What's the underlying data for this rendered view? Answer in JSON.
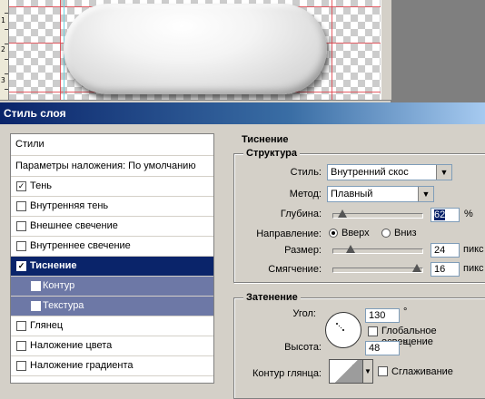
{
  "ruler": {
    "n1": "1",
    "n2": "2",
    "n3": "3"
  },
  "dialog": {
    "title": "Стиль слоя"
  },
  "stylelist": {
    "header": "Стили",
    "blending": "Параметры наложения: По умолчанию",
    "items": [
      {
        "label": "Тень",
        "checked": true
      },
      {
        "label": "Внутренняя тень",
        "checked": false
      },
      {
        "label": "Внешнее свечение",
        "checked": false
      },
      {
        "label": "Внутреннее свечение",
        "checked": false
      },
      {
        "label": "Тиснение",
        "checked": true
      },
      {
        "label": "Контур",
        "checked": false
      },
      {
        "label": "Текстура",
        "checked": false
      },
      {
        "label": "Глянец",
        "checked": false
      },
      {
        "label": "Наложение цвета",
        "checked": false
      },
      {
        "label": "Наложение градиента",
        "checked": false
      }
    ]
  },
  "bevel": {
    "title": "Тиснение",
    "structure": {
      "title": "Структура",
      "style_label": "Стиль:",
      "style_value": "Внутренний скос",
      "method_label": "Метод:",
      "method_value": "Плавный",
      "depth_label": "Глубина:",
      "depth_value": "62",
      "depth_unit": "%",
      "direction_label": "Направление:",
      "up_label": "Вверх",
      "down_label": "Вниз",
      "direction_selected": "up",
      "size_label": "Размер:",
      "size_value": "24",
      "size_unit": "пикс",
      "soften_label": "Смягчение:",
      "soften_value": "16",
      "soften_unit": "пикс",
      "depth_slider": 0.05,
      "size_slider": 0.16,
      "soften_slider": 0.97
    },
    "shading": {
      "title": "Затенение",
      "angle_label": "Угол:",
      "angle_value": "130",
      "degree": "°",
      "global_light_label": "Глобальное освещение",
      "global_light_checked": false,
      "altitude_label": "Высота:",
      "altitude_value": "48",
      "gloss_label": "Контур глянца:",
      "antialias_label": "Сглаживание",
      "antialias_checked": false
    }
  },
  "colors": {
    "title_bar": "#0a246a",
    "selection": "#0a246a",
    "sub_rows": "#6d78a6",
    "guides": "#e0414a"
  }
}
